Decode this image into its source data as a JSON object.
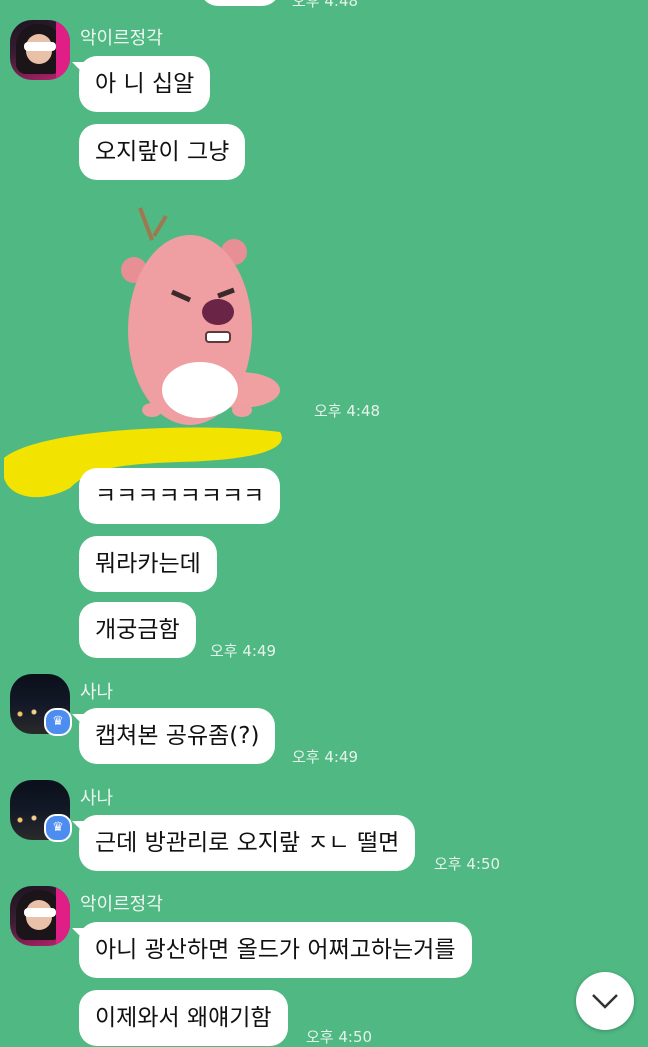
{
  "top_bubble_time": "오후 4:48",
  "groups": [
    {
      "sender": "악이르정각",
      "messages": [
        "아 니 십알",
        "오지랖이 그냥"
      ],
      "sticker_time": "오후 4:48",
      "more_messages": [
        "ㅋㅋㅋㅋㅋㅋㅋㅋ",
        "뭐라카는데",
        "개궁금함"
      ],
      "time": "오후 4:49"
    },
    {
      "sender": "사나",
      "messages": [
        "캡쳐본 공유좀(?)"
      ],
      "time": "오후 4:49"
    },
    {
      "sender": "사나",
      "messages": [
        "근데 방관리로 오지랖 ㅈㄴ 떨면"
      ],
      "time": "오후 4:50"
    },
    {
      "sender": "악이르정각",
      "messages": [
        "아니 광산하면 올드가 어쩌고하는거를",
        "이제와서 왜얘기함"
      ],
      "time": "오후 4:50"
    }
  ],
  "icons": {
    "scroll_down": "chevron-down-icon",
    "crown": "crown-icon"
  },
  "colors": {
    "background": "#50b883",
    "bubble": "#ffffff",
    "highlight": "#f2e400"
  }
}
